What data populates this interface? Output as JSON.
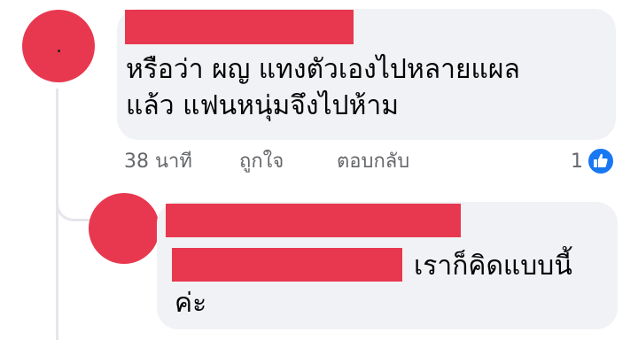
{
  "comment1": {
    "text_line1": "หรือว่า ผญ แทงตัวเองไปหลายแผล",
    "text_line2": "แล้ว แฟนหนุ่มจึงไปห้าม",
    "timestamp": "38 นาที",
    "like_label": "ถูกใจ",
    "reply_label": "ตอบกลับ",
    "reaction_count": "1",
    "reaction_icon": "thumbs-up-icon"
  },
  "comment2": {
    "text_line1": "เราก็คิดแบบนี้",
    "text_line2": "ค่ะ"
  },
  "colors": {
    "redaction": "#e8384f",
    "bubble": "#f0f2f5",
    "meta_text": "#65676b",
    "like_blue": "#1877f2"
  }
}
